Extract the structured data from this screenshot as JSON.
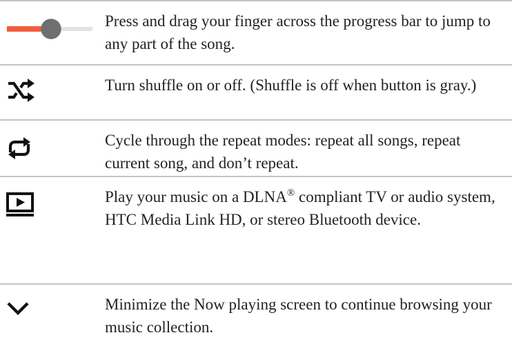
{
  "colors": {
    "progress_fill": "#f25c3c",
    "progress_track": "#e3e3e3",
    "thumb": "#6f6f6f",
    "icon": "#111111",
    "rule": "#c4c4c4",
    "text": "#222222"
  },
  "rows": [
    {
      "icon": "progress-bar-icon",
      "progress_fraction": 0.5,
      "text": "Press and drag your finger across the progress bar to jump to any part of the song."
    },
    {
      "icon": "shuffle-icon",
      "text": "Turn shuffle on or off. (Shuffle is off when button is gray.)"
    },
    {
      "icon": "repeat-icon",
      "text": "Cycle through the repeat modes: repeat all songs, repeat current song, and don’t repeat."
    },
    {
      "icon": "play-on-screen-icon",
      "text_before": "Play your music on a DLNA",
      "text_sup": "®",
      "text_after": " compliant TV or audio system, HTC Media Link HD, or stereo Bluetooth device."
    },
    {
      "icon": "chevron-down-icon",
      "text": "Minimize the Now playing screen to continue browsing your music collection."
    }
  ]
}
